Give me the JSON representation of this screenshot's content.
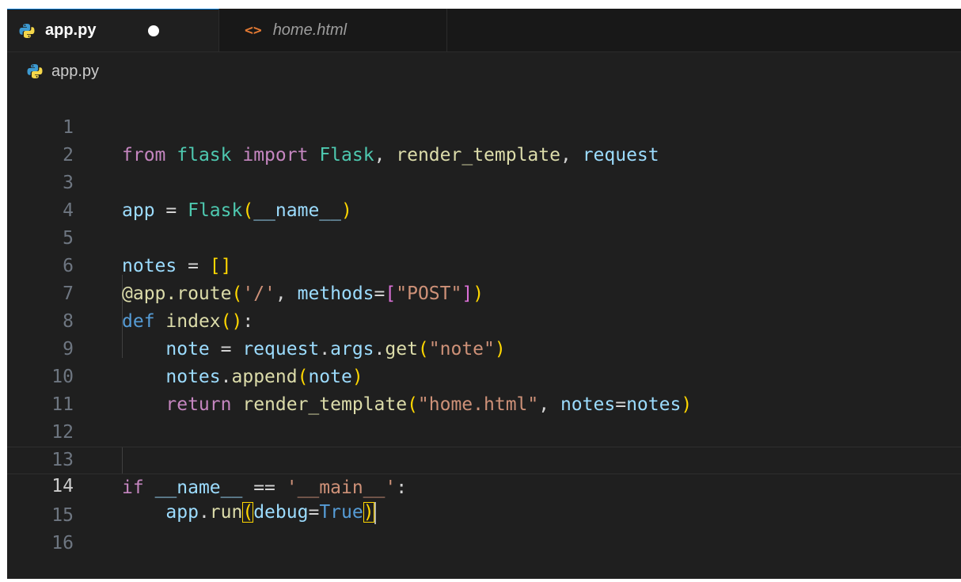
{
  "tabs": [
    {
      "label": "app.py",
      "icon": "python-icon",
      "active": true,
      "unsaved": true
    },
    {
      "label": "home.html",
      "icon": "html-icon",
      "active": false,
      "unsaved": false
    }
  ],
  "breadcrumb": {
    "file": "app.py",
    "icon": "python-icon"
  },
  "editor": {
    "current_line": 14,
    "lines": [
      {
        "n": "1",
        "text": "from flask import Flask, render_template, request"
      },
      {
        "n": "2",
        "text": ""
      },
      {
        "n": "3",
        "text": "app = Flask(__name__)"
      },
      {
        "n": "4",
        "text": ""
      },
      {
        "n": "5",
        "text": "notes = []"
      },
      {
        "n": "6",
        "text": "@app.route('/', methods=[\"POST\"])"
      },
      {
        "n": "7",
        "text": "def index():"
      },
      {
        "n": "8",
        "text": "    note = request.args.get(\"note\")"
      },
      {
        "n": "9",
        "text": "    notes.append(note)"
      },
      {
        "n": "10",
        "text": "    return render_template(\"home.html\", notes=notes)"
      },
      {
        "n": "11",
        "text": ""
      },
      {
        "n": "12",
        "text": ""
      },
      {
        "n": "13",
        "text": "if __name__ == '__main__':"
      },
      {
        "n": "14",
        "text": "    app.run(debug=True)"
      },
      {
        "n": "15",
        "text": ""
      },
      {
        "n": "16",
        "text": ""
      }
    ]
  },
  "colors": {
    "background": "#1f1f1f",
    "tab_bar": "#181818",
    "keyword_flow": "#c586c0",
    "keyword": "#569cd6",
    "function": "#dcdcaa",
    "class": "#4ec9b0",
    "variable": "#9cdcfe",
    "string": "#ce9178",
    "bracket_level1": "#ffd700",
    "bracket_level2": "#da70d6",
    "html_icon": "#e37933",
    "python_icon": "#3d9ad1"
  }
}
